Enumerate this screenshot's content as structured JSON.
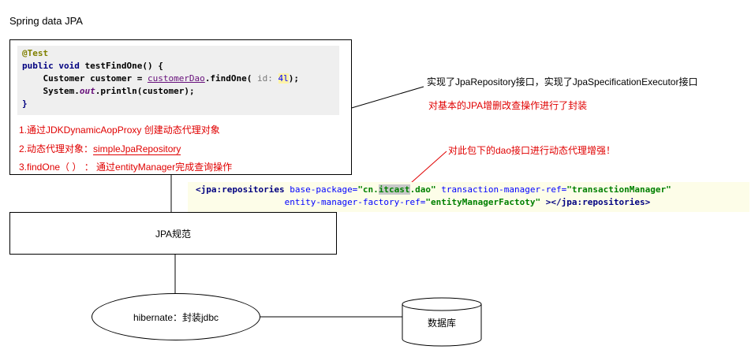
{
  "title": "Spring data JPA",
  "code": {
    "annotation": "@Test",
    "line2_kw": "public void ",
    "line2_method": "testFindOne() {",
    "line3_type": "Customer customer = ",
    "line3_dao": "customerDao",
    "line3_call": ".findOne( ",
    "line3_hint": "id: ",
    "line3_num": "4l",
    "line3_end": ");",
    "line4_a": "System.",
    "line4_out": "out",
    "line4_b": ".println(customer);",
    "line5": "}"
  },
  "steps": {
    "s1": "1.通过JDKDynamicAopProxy 创建动态代理对象",
    "s2_prefix": "2.动态代理对象：",
    "s2_value": "simpleJpaRepository",
    "s3": "3.findOne（ ）  ：  通过entityManager完成查询操作"
  },
  "xml": {
    "open": "<jpa:repositories",
    "attr1": " base-package=",
    "val1_a": "\"cn.",
    "val1_hl": "itcast",
    "val1_b": ".dao\"",
    "attr2": " transaction-manager-ref=",
    "val2": "\"transactionManager\"",
    "indent": "                 ",
    "attr3": "entity-manager-factory-ref=",
    "val3": "\"entityManagerFactoty\"",
    "close_mid": " ></",
    "close_tag": "jpa:repositories",
    "close_end": ">"
  },
  "jpa_box": "JPA规范",
  "hibernate": "hibernate：封装jdbc",
  "database": "数据库",
  "annotations": {
    "a1": "实现了JpaRepository接口，实现了JpaSpecificationExecutor接口",
    "a2": "对基本的JPA增删改查操作进行了封装",
    "a3": "对此包下的dao接口进行动态代理增强！"
  }
}
